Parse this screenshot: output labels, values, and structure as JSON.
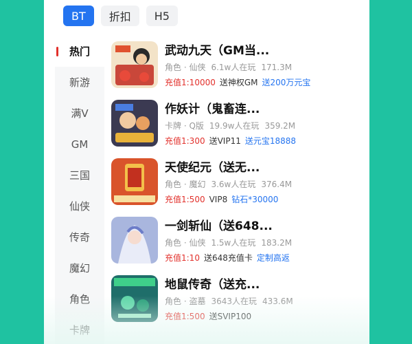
{
  "tabs": [
    {
      "label": "BT",
      "active": true
    },
    {
      "label": "折扣",
      "active": false
    },
    {
      "label": "H5",
      "active": false
    }
  ],
  "categories": [
    {
      "label": "热门",
      "active": true
    },
    {
      "label": "新游"
    },
    {
      "label": "满V"
    },
    {
      "label": "GM"
    },
    {
      "label": "三国"
    },
    {
      "label": "仙侠"
    },
    {
      "label": "传奇"
    },
    {
      "label": "魔幻"
    },
    {
      "label": "角色"
    },
    {
      "label": "卡牌"
    }
  ],
  "games": [
    {
      "title": "武动九天（GM当...",
      "genre": "角色 · 仙侠",
      "players": "6.1w人在玩",
      "size": "171.3M",
      "rate": "充值1:10000",
      "gift": "送神权GM",
      "bonus": "送200万元宝",
      "thumb_color": "#c9473a"
    },
    {
      "title": "作妖计（鬼畜连...",
      "genre": "卡牌 · Q版",
      "players": "19.9w人在玩",
      "size": "359.2M",
      "rate": "充值1:300",
      "gift": "送VIP11",
      "bonus": "送元宝18888",
      "thumb_color": "#3b3a52"
    },
    {
      "title": "天使纪元（送无...",
      "genre": "角色 · 魔幻",
      "players": "3.6w人在玩",
      "size": "376.4M",
      "rate": "充值1:500",
      "gift": "VIP8",
      "bonus": "钻石*30000",
      "thumb_color": "#d9542b"
    },
    {
      "title": "一剑斩仙（送648...",
      "genre": "角色 · 仙侠",
      "players": "1.5w人在玩",
      "size": "183.2M",
      "rate": "充值1:10",
      "gift": "送648充值卡",
      "bonus": "定制高返",
      "thumb_color": "#a9b6de"
    },
    {
      "title": "地鼠传奇（送充...",
      "genre": "角色 · 盗墓",
      "players": "3643人在玩",
      "size": "433.6M",
      "rate": "充值1:500",
      "gift": "送SVIP100",
      "bonus": "",
      "thumb_color": "#1f6e6a"
    }
  ]
}
